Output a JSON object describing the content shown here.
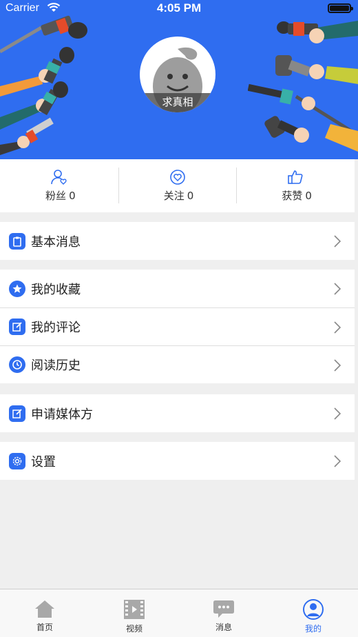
{
  "status_bar": {
    "carrier": "Carrier",
    "time": "4:05 PM"
  },
  "profile": {
    "name": "求真相"
  },
  "stats": [
    {
      "label": "粉丝",
      "count": "0",
      "icon": "user-heart-icon"
    },
    {
      "label": "关注",
      "count": "0",
      "icon": "heart-circle-icon"
    },
    {
      "label": "获赞",
      "count": "0",
      "icon": "thumbs-up-icon"
    }
  ],
  "menu": {
    "basic_info": "基本消息",
    "favorites": "我的收藏",
    "comments": "我的评论",
    "history": "阅读历史",
    "apply_media": "申请媒体方",
    "settings": "设置"
  },
  "tabs": [
    {
      "label": "首页",
      "icon": "home-icon"
    },
    {
      "label": "视频",
      "icon": "film-icon"
    },
    {
      "label": "消息",
      "icon": "chat-icon"
    },
    {
      "label": "我的",
      "icon": "profile-icon",
      "active": true
    }
  ],
  "colors": {
    "accent": "#2f6df0",
    "inactive_icon": "#a8a8a8"
  }
}
